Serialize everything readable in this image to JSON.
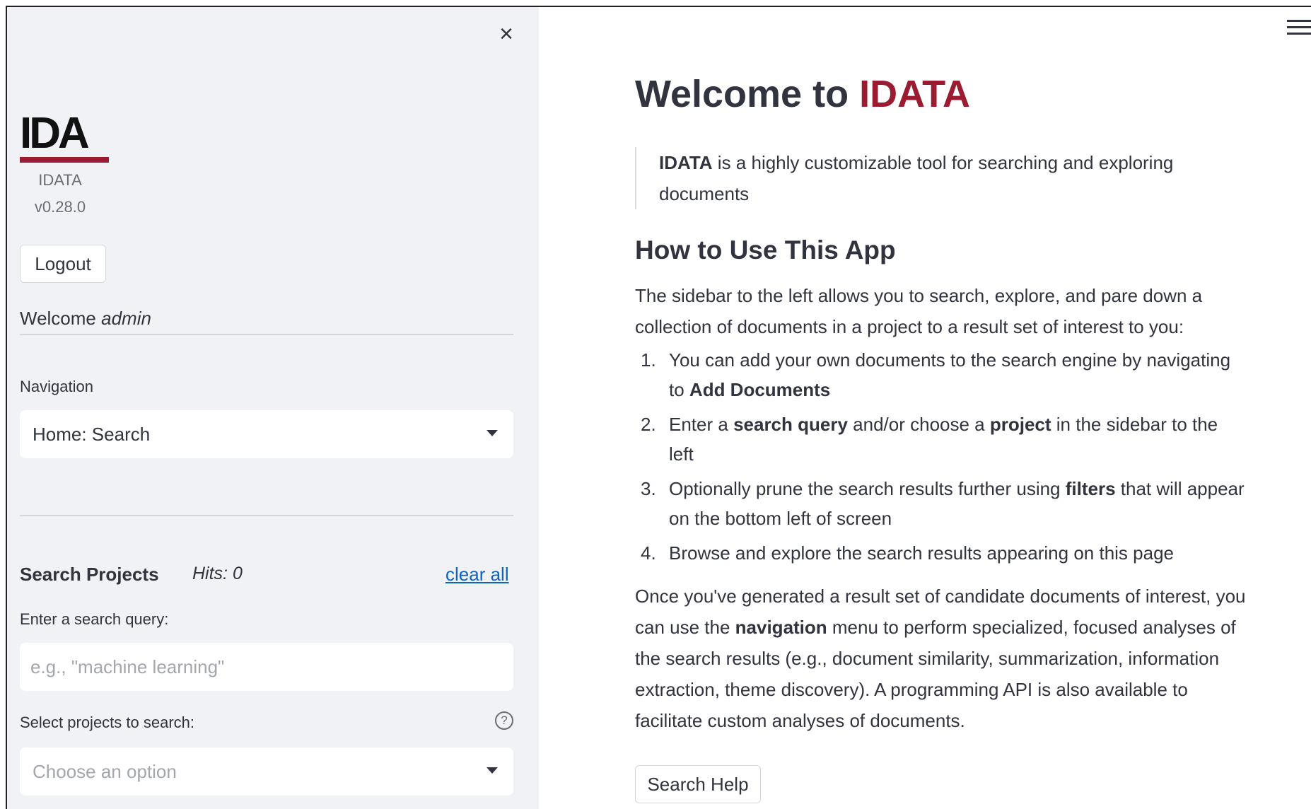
{
  "sidebar": {
    "logo_text": "IDA",
    "app_name": "IDATA",
    "version": "v0.28.0",
    "logout_label": "Logout",
    "welcome_prefix": "Welcome",
    "welcome_user": "admin",
    "navigation_label": "Navigation",
    "navigation_value": "Home: Search",
    "search_projects_title": "Search Projects",
    "hits": "Hits: 0",
    "clear_all": "clear all",
    "query_label": "Enter a search query:",
    "query_placeholder": "e.g., \"machine learning\"",
    "projects_label": "Select projects to search:",
    "projects_placeholder": "Choose an option"
  },
  "main": {
    "title_prefix": "Welcome to ",
    "title_accent": "IDATA",
    "quote_bold": "IDATA",
    "quote_rest": " is a highly customizable tool for searching and exploring documents",
    "how_to_title": "How to Use This App",
    "intro": "The sidebar to the left allows you to search, explore, and pare down a collection of documents in a project to a result set of interest to you:",
    "steps": [
      {
        "num": "1.",
        "a": "You can add your own documents to the search engine by navigating to ",
        "b1": "Add Documents",
        "c": "",
        "b2": "",
        "d": ""
      },
      {
        "num": "2.",
        "a": "Enter a ",
        "b1": "search query",
        "c": " and/or choose a ",
        "b2": "project",
        "d": " in the sidebar to the left"
      },
      {
        "num": "3.",
        "a": "Optionally prune the search results further using ",
        "b1": "filters",
        "c": " that will appear on the bottom left of screen",
        "b2": "",
        "d": ""
      },
      {
        "num": "4.",
        "a": "Browse and explore the search results appearing on this page",
        "b1": "",
        "c": "",
        "b2": "",
        "d": ""
      }
    ],
    "outro_a": "Once you've generated a result set of candidate documents of interest, you can use the ",
    "outro_bold": "navigation",
    "outro_b": " menu to perform specialized, focused analyses of the search results (e.g., document similarity, summarization, information extraction, theme discovery). A programming API is also available to facilitate custom analyses of documents.",
    "search_help_label": "Search Help"
  },
  "colors": {
    "accent": "#9b1b30",
    "link": "#0a66c2",
    "sidebar_bg": "#f0f2f6"
  },
  "icons": {
    "close": "close-icon",
    "menu": "hamburger-menu-icon",
    "help": "question-circle-icon",
    "dropdown": "caret-down-icon"
  }
}
